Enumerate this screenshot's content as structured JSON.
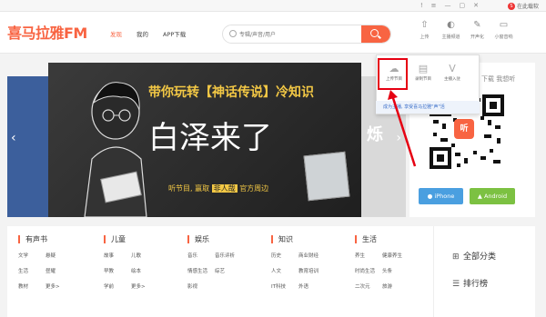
{
  "topbar": {
    "icons": [
      "!",
      "≡",
      "—",
      "▢",
      "✕"
    ],
    "download_label": "在此载软"
  },
  "header": {
    "brand": "喜马拉雅FM",
    "nav": [
      {
        "label": "发现",
        "active": true
      },
      {
        "label": "我的",
        "active": false
      },
      {
        "label": "APP下载",
        "active": false
      }
    ],
    "search_placeholder": "专辑/声音/用户",
    "tools": [
      {
        "icon": "upload-icon",
        "glyph": "⇧",
        "label": "上传"
      },
      {
        "icon": "live-icon",
        "glyph": "◐",
        "label": "主播频道"
      },
      {
        "icon": "record-icon",
        "glyph": "✎",
        "label": "开声化"
      },
      {
        "icon": "mini-icon",
        "glyph": "▭",
        "label": "小窗音响"
      }
    ]
  },
  "dropdown": {
    "items": [
      {
        "icon": "cloud-upload-icon",
        "glyph": "☁",
        "label": "上传节目"
      },
      {
        "icon": "record-program-icon",
        "glyph": "▤",
        "label": "录制节目"
      },
      {
        "icon": "anchor-icon",
        "glyph": "V",
        "label": "主播入驻"
      }
    ],
    "link": "成为主播, 享受喜马拉雅\"声\"活"
  },
  "banner": {
    "title": "带你玩转【神话传说】冷知识",
    "main": "白泽来了",
    "sub_prefix": "听节目, 赢取",
    "sub_highlight": "非人哉",
    "sub_suffix": "官方周边",
    "right_char": "烁"
  },
  "sidebar": {
    "head_text": "下载 我想听",
    "qr_center": "听",
    "iphone_label": " iPhone",
    "android_label": " Android"
  },
  "categories": [
    {
      "title": "有声书",
      "rows": [
        [
          "文学",
          "悬疑"
        ],
        [
          "生活",
          "昼耀"
        ],
        [
          "教材",
          "更多>"
        ]
      ]
    },
    {
      "title": "儿童",
      "rows": [
        [
          "故事",
          "儿歌"
        ],
        [
          "早教",
          "绘本"
        ],
        [
          "学前",
          "更多>"
        ]
      ]
    },
    {
      "title": "娱乐",
      "rows": [
        [
          "音乐",
          "音乐评析"
        ],
        [
          "情感生活",
          "综艺"
        ],
        [
          "影视",
          ""
        ]
      ]
    },
    {
      "title": "知识",
      "rows": [
        [
          "历史",
          "商业财经"
        ],
        [
          "人文",
          "教育培训"
        ],
        [
          "IT科技",
          "外语"
        ]
      ]
    },
    {
      "title": "生活",
      "rows": [
        [
          "养生",
          "健康养生"
        ],
        [
          "时尚生活",
          "头条"
        ],
        [
          "二次元",
          "旅游"
        ]
      ]
    }
  ],
  "right_links": [
    {
      "icon": "all-categories-icon",
      "glyph": "⊞",
      "label": "全部分类"
    },
    {
      "icon": "ranking-icon",
      "glyph": "☰",
      "label": "排行榜"
    }
  ],
  "colors": {
    "brand": "#f86442",
    "highlight_box": "#e60012",
    "iphone": "#4a9fe0",
    "android": "#7cc142"
  }
}
